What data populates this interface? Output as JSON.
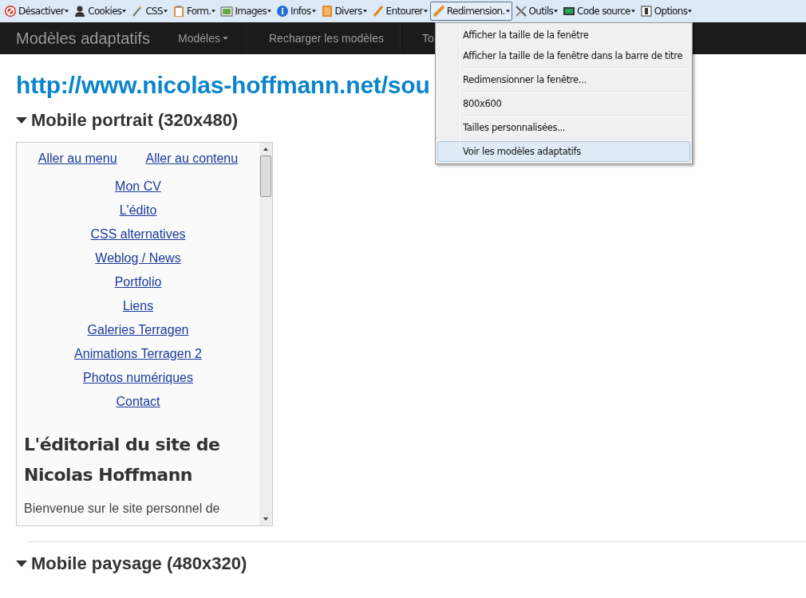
{
  "toolbar": [
    {
      "label": "Désactiver",
      "selected": false
    },
    {
      "label": "Cookies",
      "selected": false
    },
    {
      "label": "CSS",
      "selected": false
    },
    {
      "label": "Form.",
      "selected": false
    },
    {
      "label": "Images",
      "selected": false
    },
    {
      "label": "Infos",
      "selected": false
    },
    {
      "label": "Divers",
      "selected": false
    },
    {
      "label": "Entourer",
      "selected": false
    },
    {
      "label": "Redimension.",
      "selected": true
    },
    {
      "label": "Outils",
      "selected": false
    },
    {
      "label": "Code source",
      "selected": false
    },
    {
      "label": "Options",
      "selected": false
    }
  ],
  "navbar": {
    "brand": "Modèles adaptatifs",
    "items": [
      {
        "label": "Modèles",
        "dropdown": true
      },
      {
        "label": "Recharger les modèles",
        "dropdown": false
      },
      {
        "label": "To",
        "dropdown": false
      }
    ]
  },
  "menu": {
    "groups": [
      [
        {
          "label": "Afficher la taille de la fenêtre",
          "selected": false
        },
        {
          "label": "Afficher la taille de la fenêtre dans la barre de titre",
          "selected": false
        }
      ],
      [
        {
          "label": "Redimensionner la fenêtre...",
          "selected": false
        }
      ],
      [
        {
          "label": "800x600",
          "selected": false
        }
      ],
      [
        {
          "label": "Tailles personnalisées...",
          "selected": false
        }
      ],
      [
        {
          "label": "Voir les modèles adaptatifs",
          "selected": true
        }
      ]
    ]
  },
  "page": {
    "url": "http://www.nicolas-hoffmann.net/sou",
    "sections": [
      {
        "title": "Mobile portrait (320x480)",
        "expanded": true,
        "frame": {
          "skip_links": [
            "Aller au menu",
            "Aller au contenu"
          ],
          "nav": [
            "Mon CV",
            "L'édito",
            "CSS alternatives",
            "Weblog / News",
            "Portfolio",
            "Liens",
            "Galeries Terragen",
            "Animations Terragen 2",
            "Photos numériques",
            "Contact"
          ],
          "heading": "L'éditorial du site de Nicolas Hoffmann",
          "paragraph": "Bienvenue sur le site personnel de"
        }
      },
      {
        "title": "Mobile paysage (480x320)",
        "expanded": true
      }
    ]
  }
}
